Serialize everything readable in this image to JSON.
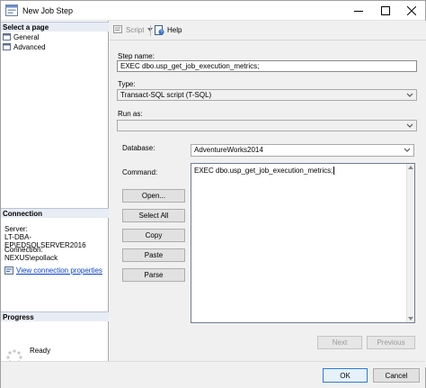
{
  "window": {
    "title": "New Job Step"
  },
  "left_pane": {
    "select_page_heading": "Select a page",
    "pages": [
      {
        "label": "General"
      },
      {
        "label": "Advanced"
      }
    ],
    "connection_heading": "Connection",
    "server_label": "Server:",
    "server_value": "LT-DBA-EP\\EDSQLSERVER2016",
    "connection_label": "Connection:",
    "connection_value": "NEXUS\\epollack",
    "view_connection_link": "View connection properties",
    "progress_heading": "Progress",
    "progress_status": "Ready"
  },
  "toolbar": {
    "script_label": "Script",
    "help_label": "Help"
  },
  "form": {
    "step_name_label": "Step name:",
    "step_name_value": "EXEC dbo.usp_get_job_execution_metrics;",
    "type_label": "Type:",
    "type_value": "Transact-SQL script (T-SQL)",
    "run_as_label": "Run as:",
    "run_as_value": "",
    "database_label": "Database:",
    "database_value": "AdventureWorks2014",
    "command_label": "Command:",
    "command_value": "EXEC dbo.usp_get_job_execution_metrics;"
  },
  "side_buttons": {
    "open": "Open...",
    "select_all": "Select All",
    "copy": "Copy",
    "paste": "Paste",
    "parse": "Parse"
  },
  "nav_buttons": {
    "next": "Next",
    "previous": "Previous"
  },
  "footer": {
    "ok": "OK",
    "cancel": "Cancel"
  },
  "colors": {
    "link": "#0b3fcf",
    "section_header": "#e8ecf4",
    "ok_border": "#2b7bd8"
  }
}
